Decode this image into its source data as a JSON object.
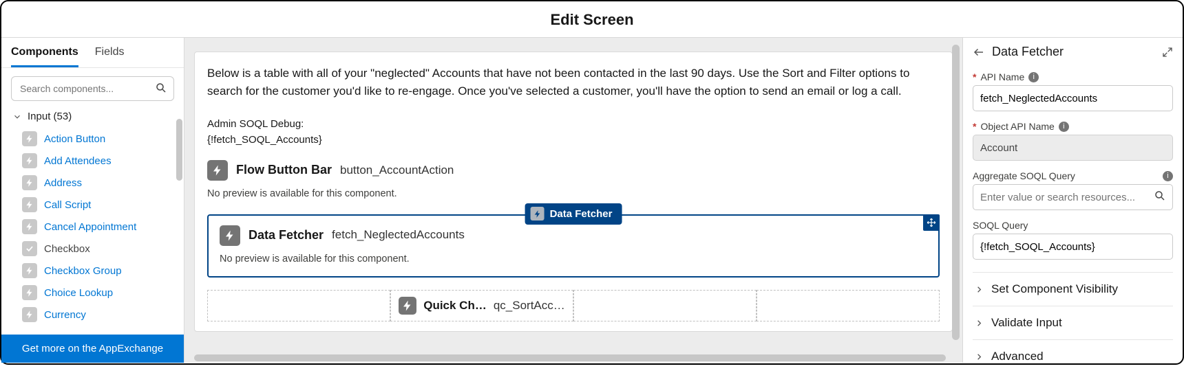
{
  "header": {
    "title": "Edit Screen"
  },
  "left": {
    "tabs": {
      "components": "Components",
      "fields": "Fields"
    },
    "search_placeholder": "Search components...",
    "category": "Input (53)",
    "items": [
      "Action Button",
      "Add Attendees",
      "Address",
      "Call Script",
      "Cancel Appointment",
      "Checkbox",
      "Checkbox Group",
      "Choice Lookup",
      "Currency"
    ],
    "appexchange": "Get more on the AppExchange"
  },
  "center": {
    "desc": "Below is a table with all of your \"neglected\" Accounts that have not been contacted in the last 90 days. Use the Sort and Filter options to search for the customer you'd like to re-engage. Once you've selected a customer, you'll have the option to send an email or log a call.",
    "debug_label": "Admin SOQL Debug:",
    "debug_value": "{!fetch_SOQL_Accounts}",
    "flowbar": {
      "title": "Flow Button Bar",
      "instance": "button_AccountAction",
      "nopreview": "No preview is available for this component."
    },
    "pill": "Data Fetcher",
    "datafetcher": {
      "title": "Data Fetcher",
      "instance": "fetch_NeglectedAccounts",
      "nopreview": "No preview is available for this component."
    },
    "quickchoice": {
      "title": "Quick Ch…",
      "instance": "qc_SortAcc…"
    }
  },
  "right": {
    "title": "Data Fetcher",
    "api_name_label": "API Name",
    "api_name_value": "fetch_NeglectedAccounts",
    "object_label": "Object API Name",
    "object_value": "Account",
    "agg_label": "Aggregate SOQL Query",
    "agg_placeholder": "Enter value or search resources...",
    "soql_label": "SOQL Query",
    "soql_value": "{!fetch_SOQL_Accounts}",
    "acc1": "Set Component Visibility",
    "acc2": "Validate Input",
    "acc3": "Advanced"
  }
}
